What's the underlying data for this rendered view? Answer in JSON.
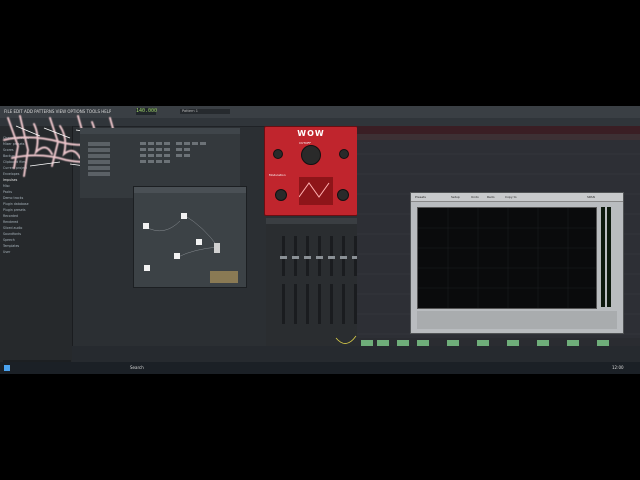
{
  "toolbar": {
    "menu": "FILE  EDIT  ADD  PATTERNS  VIEW  OPTIONS  TOOLS  HELP",
    "tempo": "140.000",
    "song_name": "Pattern 1"
  },
  "logo": {
    "alt": "band logo"
  },
  "browser": {
    "items": [
      "Channel presets",
      "Mixer presets",
      "Scores",
      "Backup",
      "Clipboard files",
      "Current project",
      "Envelopes",
      "Impulses",
      "Misc",
      "Packs",
      "Demo tracks",
      "Plugin database",
      "Plugin presets",
      "Recorded",
      "Rendered",
      "Sliced audio",
      "Soundfonts",
      "Speech",
      "Templates",
      "User"
    ]
  },
  "plugin_wow": {
    "title": "WOW",
    "cutoff_label": "CUTOFF",
    "modulation_label": "Modulation"
  },
  "spectrum": {
    "title": "SPAN",
    "buttons": [
      "Presets",
      "Setup",
      "Undo",
      "Redo",
      "Copy to"
    ]
  },
  "taskbar": {
    "search": "Search",
    "time": "12:00"
  }
}
